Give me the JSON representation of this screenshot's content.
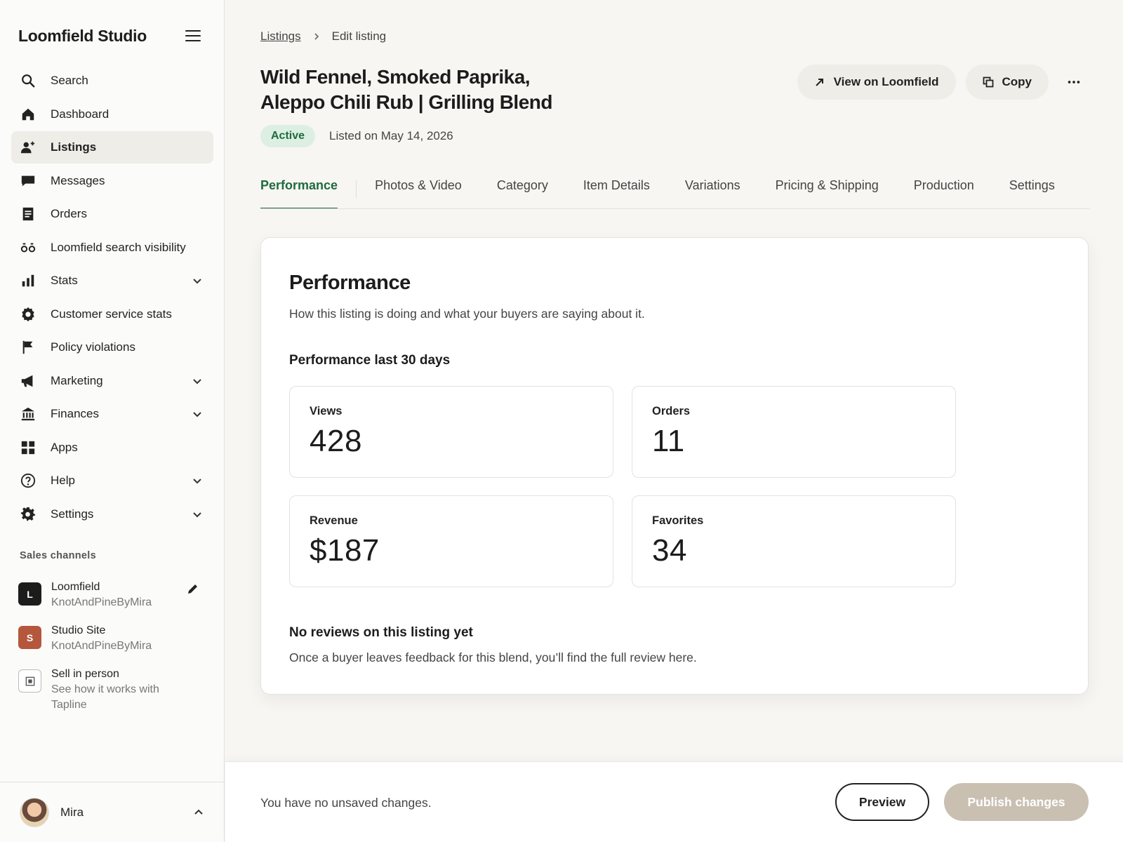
{
  "sidebar": {
    "brand": "Loomfield Studio",
    "items": [
      {
        "label": "Search",
        "icon": "search-icon"
      },
      {
        "label": "Dashboard",
        "icon": "home-icon"
      },
      {
        "label": "Listings",
        "icon": "listings-icon",
        "active": true
      },
      {
        "label": "Messages",
        "icon": "message-icon"
      },
      {
        "label": "Orders",
        "icon": "orders-icon"
      },
      {
        "label": "Loomfield search visibility",
        "icon": "visibility-icon"
      },
      {
        "label": "Stats",
        "icon": "stats-icon",
        "expandable": true
      },
      {
        "label": "Customer service stats",
        "icon": "gear-badge-icon"
      },
      {
        "label": "Policy violations",
        "icon": "flag-icon"
      },
      {
        "label": "Marketing",
        "icon": "megaphone-icon",
        "expandable": true
      },
      {
        "label": "Finances",
        "icon": "bank-icon",
        "expandable": true
      },
      {
        "label": "Apps",
        "icon": "apps-icon"
      },
      {
        "label": "Help",
        "icon": "help-icon",
        "expandable": true
      },
      {
        "label": "Settings",
        "icon": "settings-icon",
        "expandable": true
      }
    ],
    "sales_channels_heading": "Sales channels",
    "channels": [
      {
        "badge": "L",
        "name": "Loomfield",
        "sub": "KnotAndPineByMira",
        "color": "#1c1c1c"
      },
      {
        "badge": "S",
        "name": "Studio Site",
        "sub": "KnotAndPineByMira",
        "color": "#b5573d"
      },
      {
        "badge": "",
        "name": "Sell in person",
        "sub": "See how it works with Tapline",
        "color": "#ffffff"
      }
    ],
    "user_name": "Mira"
  },
  "breadcrumb": {
    "parent": "Listings",
    "current": "Edit listing"
  },
  "listing": {
    "title": "Wild Fennel, Smoked Paprika, Aleppo Chili Rub | Grilling Blend",
    "status": "Active",
    "listed_on": "Listed on May 14, 2026"
  },
  "actions": {
    "view": "View on Loomfield",
    "copy": "Copy"
  },
  "tabs": [
    "Performance",
    "Photos & Video",
    "Category",
    "Item Details",
    "Variations",
    "Pricing & Shipping",
    "Production",
    "Settings"
  ],
  "performance": {
    "title": "Performance",
    "subtitle": "How this listing is doing and what your buyers are saying about it.",
    "period_heading": "Performance last 30 days",
    "stats": [
      {
        "label": "Views",
        "value": "428"
      },
      {
        "label": "Orders",
        "value": "11"
      },
      {
        "label": "Revenue",
        "value": "$187"
      },
      {
        "label": "Favorites",
        "value": "34"
      }
    ],
    "reviews_title": "No reviews on this listing yet",
    "reviews_sub": "Once a buyer leaves feedback for this blend, you’ll find the full review here."
  },
  "footer": {
    "status_text": "You have no unsaved changes.",
    "preview_label": "Preview",
    "publish_label": "Publish changes"
  },
  "colors": {
    "accent": "#1e6b3e",
    "badge_bg": "#dcefe2",
    "publish_disabled": "#c9c0b2"
  }
}
